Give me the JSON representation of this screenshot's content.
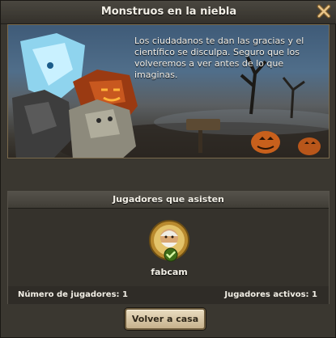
{
  "dialog": {
    "title": "Monstruos en la niebla",
    "close_icon": "close-x-icon"
  },
  "story": {
    "text": "Los ciudadanos te dan las gracias y el científico se disculpa. Seguro que los volveremos a ver antes de lo que imaginas."
  },
  "attending": {
    "title": "Jugadores que asisten",
    "players": [
      {
        "name": "fabcam",
        "status_icon": "checkmark-icon"
      }
    ],
    "players_count_label": "Número de jugadores: 1",
    "active_players_label": "Jugadores activos: 1"
  },
  "actions": {
    "home_label": "Volver a casa"
  },
  "colors": {
    "panel": "#3a3730",
    "accent_gold": "#c9a24b",
    "check_green": "#7fbf3a"
  }
}
